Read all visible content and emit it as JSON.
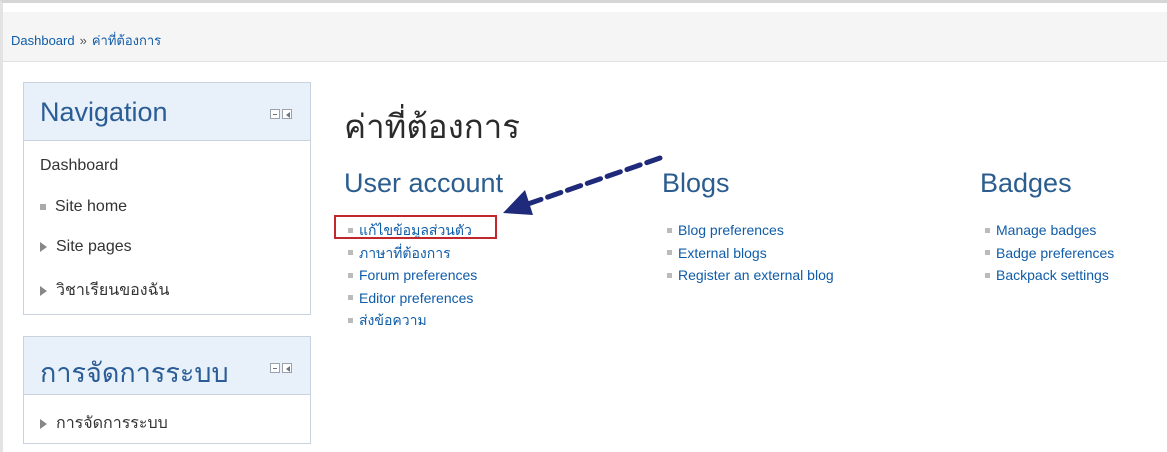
{
  "breadcrumb": {
    "home": "Dashboard",
    "separator": "»",
    "current": "ค่าที่ต้องการ"
  },
  "navigation_block": {
    "title": "Navigation",
    "items": [
      {
        "label": "Dashboard",
        "icon": "none"
      },
      {
        "label": "Site home",
        "icon": "bullet-square"
      },
      {
        "label": "Site pages",
        "icon": "arrow-right"
      },
      {
        "label": "วิชาเรียนของฉัน",
        "icon": "arrow-right"
      }
    ]
  },
  "admin_block": {
    "title": "การจัดการระบบ",
    "items": [
      {
        "label": "การจัดการระบบ",
        "icon": "arrow-right"
      }
    ]
  },
  "main": {
    "page_title": "ค่าที่ต้องการ",
    "sections": [
      {
        "title": "User account",
        "links": [
          "แก้ไขข้อมูลส่วนตัว",
          "ภาษาที่ต้องการ",
          "Forum preferences",
          "Editor preferences",
          "ส่งข้อความ"
        ]
      },
      {
        "title": "Blogs",
        "links": [
          "Blog preferences",
          "External blogs",
          "Register an external blog"
        ]
      },
      {
        "title": "Badges",
        "links": [
          "Manage badges",
          "Badge preferences",
          "Backpack settings"
        ]
      }
    ]
  },
  "annotation": {
    "highlight_color": "#c0282e",
    "arrow_color": "#1f2a7a"
  },
  "colors": {
    "link": "#0f5ca8",
    "block_header_bg": "#e8f0f9",
    "block_title": "#2a5d96",
    "section_title": "#2b5d8f"
  }
}
